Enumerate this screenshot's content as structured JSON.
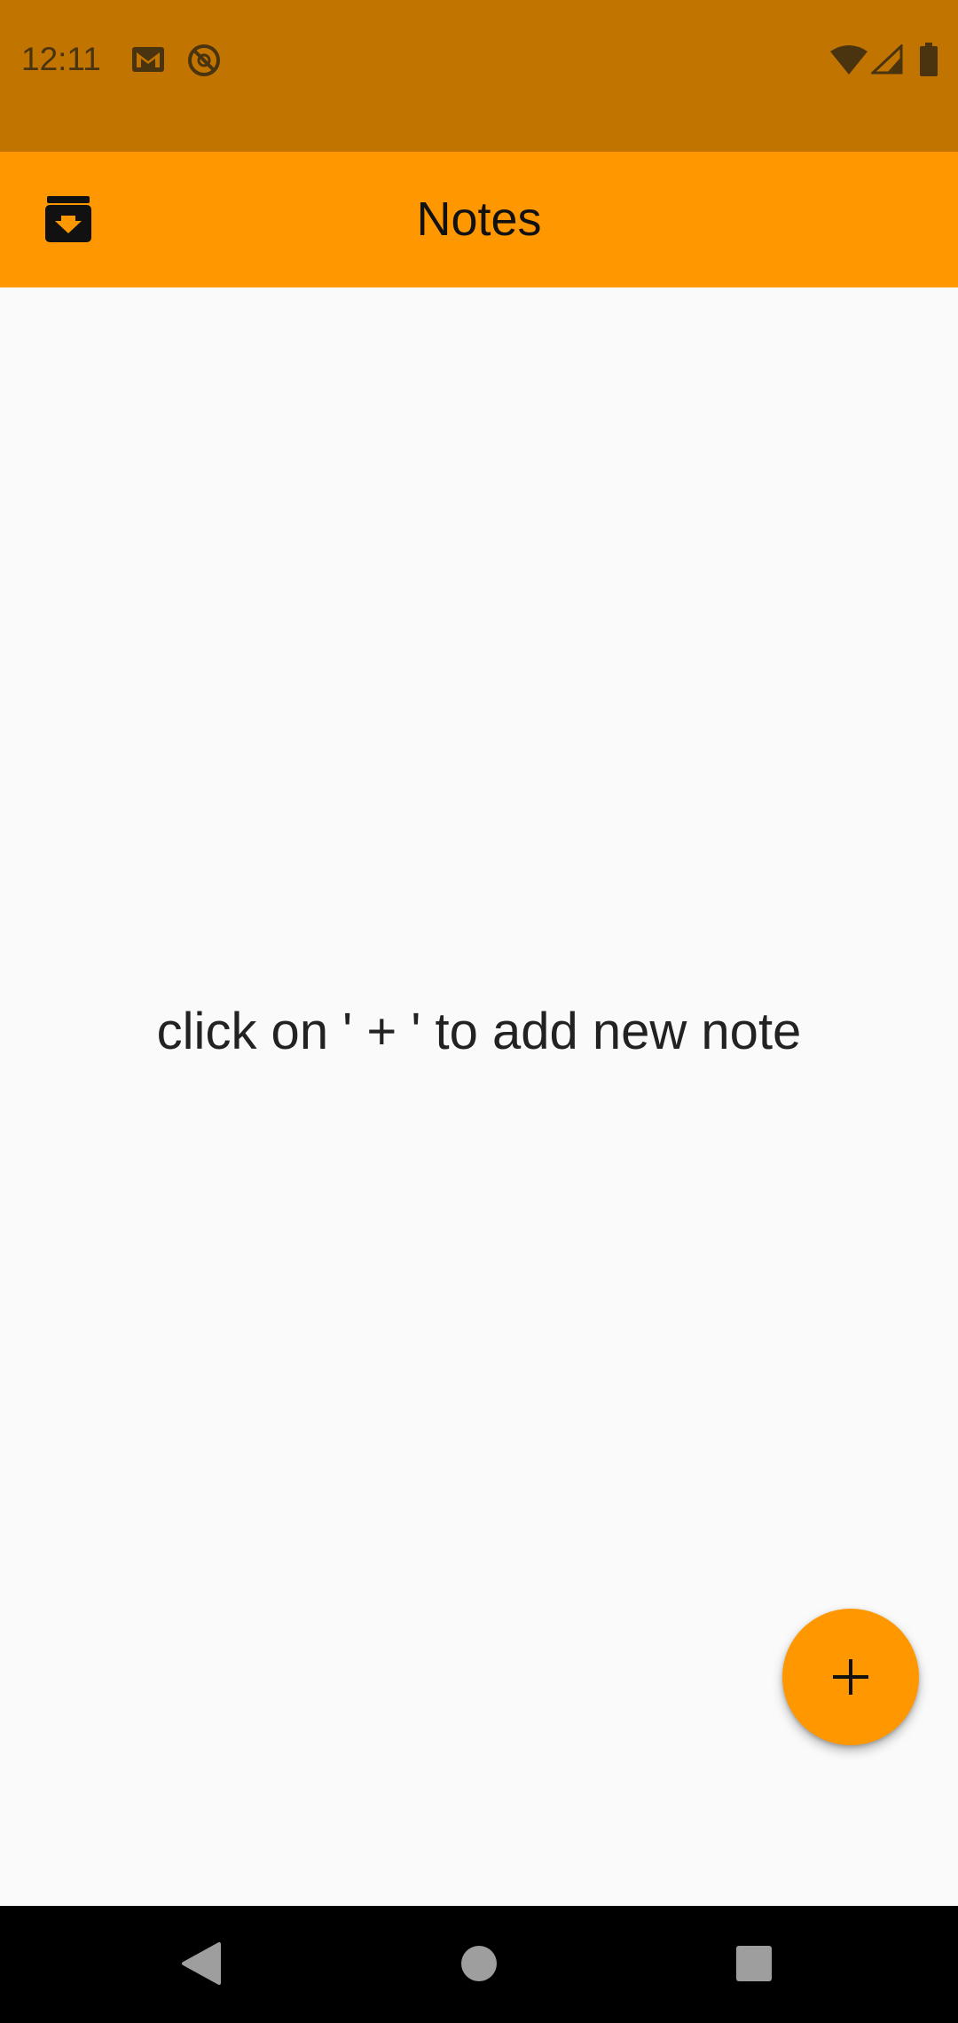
{
  "status_bar": {
    "time": "12:11",
    "icons": [
      "gmail-icon",
      "at-sign-icon",
      "wifi-icon",
      "signal-icon",
      "battery-icon"
    ]
  },
  "app_bar": {
    "title": "Notes",
    "archive_icon": "archive-icon"
  },
  "main": {
    "empty_message": "click on ' + ' to add new note"
  },
  "fab": {
    "icon": "plus-icon"
  },
  "nav_bar": {
    "icons": [
      "back-icon",
      "home-icon",
      "recents-icon"
    ]
  },
  "colors": {
    "status_bar": "#c27400",
    "app_bar": "#ff9800",
    "fab": "#ff9800",
    "background": "#fafafa"
  }
}
